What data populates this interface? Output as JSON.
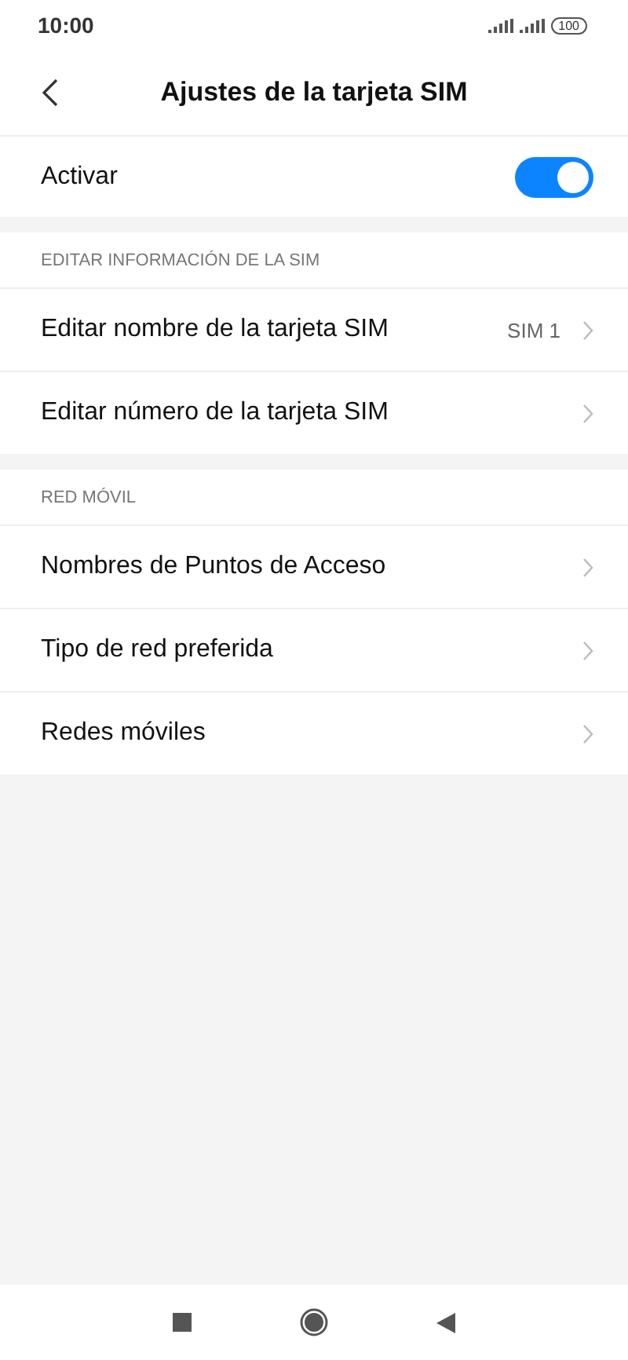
{
  "status_bar": {
    "time": "10:00",
    "battery": "100"
  },
  "header": {
    "title": "Ajustes de la tarjeta SIM"
  },
  "toggle_row": {
    "label": "Activar",
    "on": true
  },
  "sections": [
    {
      "title": "EDITAR INFORMACIÓN DE LA SIM",
      "items": [
        {
          "label": "Editar nombre de la tarjeta SIM",
          "value": "SIM 1"
        },
        {
          "label": "Editar número de la tarjeta SIM"
        }
      ]
    },
    {
      "title": "RED MÓVIL",
      "items": [
        {
          "label": "Nombres de Puntos de Acceso"
        },
        {
          "label": "Tipo de red preferida"
        },
        {
          "label": "Redes móviles"
        }
      ]
    }
  ]
}
